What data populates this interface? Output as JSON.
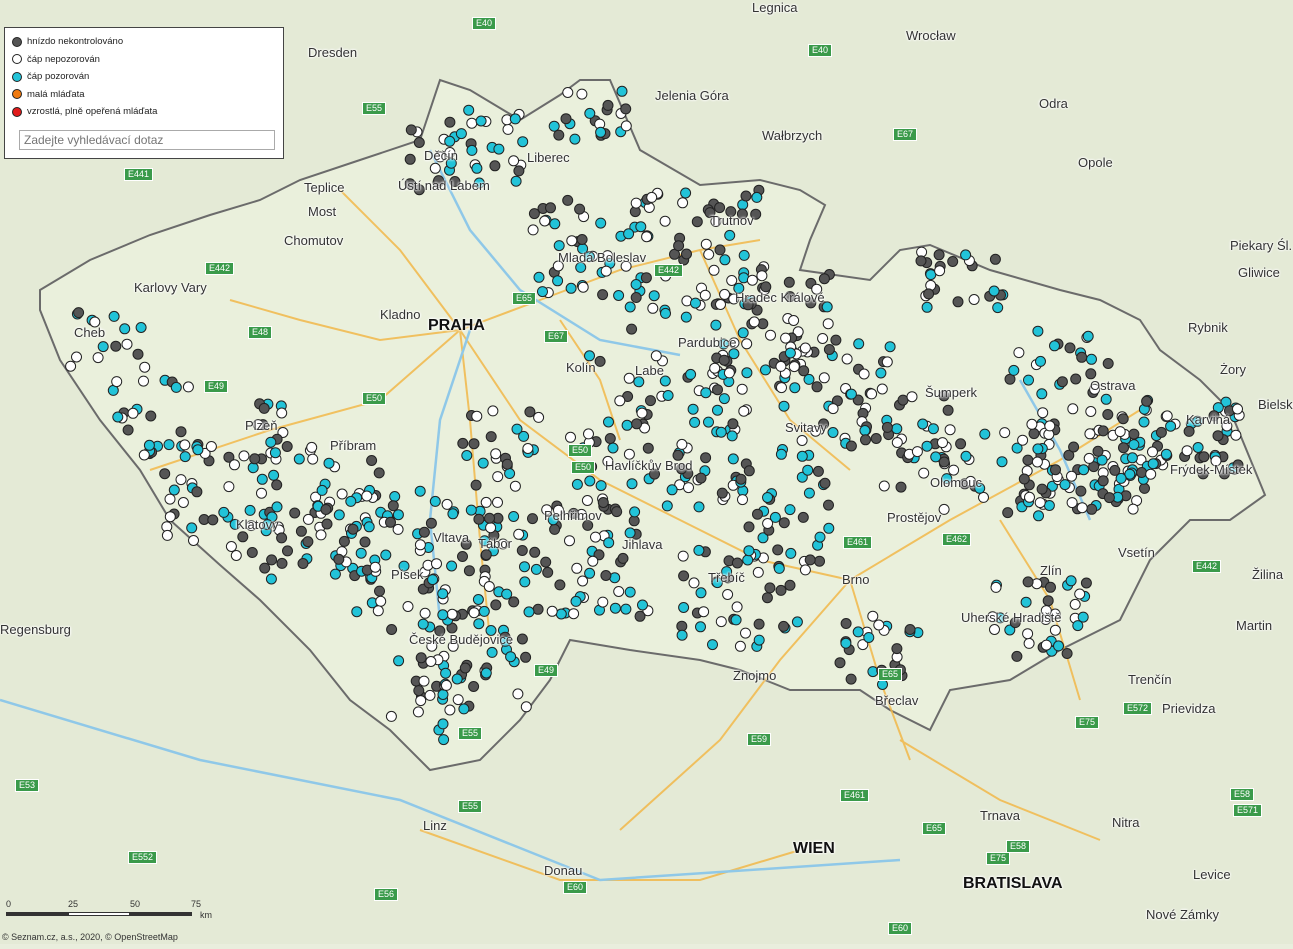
{
  "legend": {
    "items": [
      {
        "label": "hnízdo nekontrolováno",
        "color": "#555555"
      },
      {
        "label": "čáp nepozorován",
        "color": "#ffffff"
      },
      {
        "label": "čáp pozorován",
        "color": "#22c3d8"
      },
      {
        "label": "malá mláďata",
        "color": "#f07a10"
      },
      {
        "label": "vzrostlá, plně opeřená mláďata",
        "color": "#e11b1b"
      }
    ],
    "search_placeholder": "Zadejte vyhledávací dotaz"
  },
  "attribution": "© Seznam.cz, a.s., 2020, © OpenStreetMap",
  "scale": {
    "ticks": [
      "0",
      "25",
      "50",
      "75"
    ],
    "unit": "km"
  },
  "cities": [
    {
      "name": "PRAHA",
      "big": true
    },
    {
      "name": "WIEN",
      "big": true
    },
    {
      "name": "BRATISLAVA",
      "big": true
    },
    {
      "name": "Dresden"
    },
    {
      "name": "Legnica"
    },
    {
      "name": "Wrocław"
    },
    {
      "name": "Jelenia Góra"
    },
    {
      "name": "Wałbrzych"
    },
    {
      "name": "Opole"
    },
    {
      "name": "Teplice"
    },
    {
      "name": "Most"
    },
    {
      "name": "Ústí nad Labem"
    },
    {
      "name": "Chomutov"
    },
    {
      "name": "Karlovy Vary"
    },
    {
      "name": "Kladno"
    },
    {
      "name": "Příbram"
    },
    {
      "name": "Plzeň"
    },
    {
      "name": "Klatovy"
    },
    {
      "name": "Kolín"
    },
    {
      "name": "Pardubice"
    },
    {
      "name": "Hradec Králové"
    },
    {
      "name": "Svitavy"
    },
    {
      "name": "Šumperk"
    },
    {
      "name": "Olomouc"
    },
    {
      "name": "Prostějov"
    },
    {
      "name": "Brno"
    },
    {
      "name": "Jihlava"
    },
    {
      "name": "Havlíčkův Brod"
    },
    {
      "name": "Pelhřimov"
    },
    {
      "name": "Tábor"
    },
    {
      "name": "Třebíč"
    },
    {
      "name": "Znojmo"
    },
    {
      "name": "Břeclav"
    },
    {
      "name": "Zlín"
    },
    {
      "name": "Vsetín"
    },
    {
      "name": "Uherské Hradiště"
    },
    {
      "name": "Ostrava"
    },
    {
      "name": "Karviná"
    },
    {
      "name": "Frýdek-Místek"
    },
    {
      "name": "Žilina"
    },
    {
      "name": "Trenčín"
    },
    {
      "name": "Prievidza"
    },
    {
      "name": "Martin"
    },
    {
      "name": "Trnava"
    },
    {
      "name": "Nitra"
    },
    {
      "name": "Levice"
    },
    {
      "name": "Nové Zámky"
    },
    {
      "name": "Linz"
    },
    {
      "name": "Regensburg"
    },
    {
      "name": "Rybnik"
    },
    {
      "name": "Żory"
    },
    {
      "name": "Bielsko"
    },
    {
      "name": "Gliwice"
    },
    {
      "name": "Piekary Śl."
    },
    {
      "name": "Trutnov"
    },
    {
      "name": "Liberec"
    },
    {
      "name": "Děčín"
    },
    {
      "name": "Mladá Boleslav"
    },
    {
      "name": "České Budějovice"
    },
    {
      "name": "Písek"
    },
    {
      "name": "Cheb"
    },
    {
      "name": "Donau"
    },
    {
      "name": "Odra"
    },
    {
      "name": "Labe"
    },
    {
      "name": "Vltava"
    }
  ],
  "roads": [
    "E40",
    "E40",
    "E55",
    "E441",
    "E67",
    "E442",
    "E48",
    "E49",
    "E50",
    "E65",
    "E67",
    "E462",
    "E461",
    "E50",
    "E442",
    "E75",
    "E572",
    "E55",
    "E59",
    "E53",
    "E552",
    "E56",
    "E60",
    "E60",
    "E58",
    "E58",
    "E571",
    "E65",
    "E75",
    "E461",
    "E49",
    "E55",
    "E442",
    "E65",
    "E50"
  ]
}
